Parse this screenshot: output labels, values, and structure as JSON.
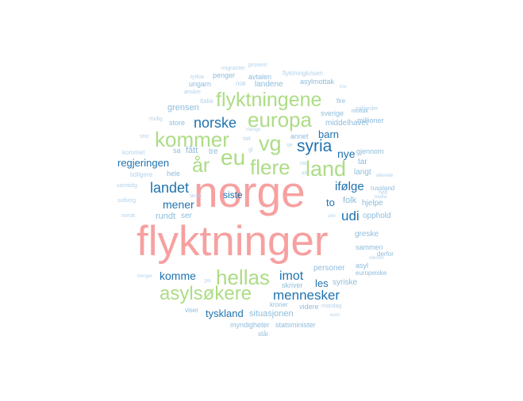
{
  "colors": {
    "background": "#ffffff",
    "pink": "#f7a0a0",
    "green": "#addc86",
    "darkblue": "#1f73b0",
    "midblue": "#8ebcdc",
    "lightblue": "#b3d3eb"
  },
  "words": [
    {
      "text": "norge",
      "color": "pink"
    },
    {
      "text": "flyktninger",
      "color": "pink"
    },
    {
      "text": "flyktningene",
      "color": "green"
    },
    {
      "text": "europa",
      "color": "green"
    },
    {
      "text": "kommer",
      "color": "green"
    },
    {
      "text": "vg",
      "color": "green"
    },
    {
      "text": "eu",
      "color": "green"
    },
    {
      "text": "syria",
      "color": "darkblue"
    },
    {
      "text": "år",
      "color": "green"
    },
    {
      "text": "flere",
      "color": "green"
    },
    {
      "text": "land",
      "color": "green"
    },
    {
      "text": "hellas",
      "color": "green"
    },
    {
      "text": "asylsøkere",
      "color": "green"
    },
    {
      "text": "norske",
      "color": "darkblue"
    },
    {
      "text": "landet",
      "color": "darkblue"
    },
    {
      "text": "regjeringen",
      "color": "darkblue"
    },
    {
      "text": "mener",
      "color": "darkblue"
    },
    {
      "text": "ifølge",
      "color": "darkblue"
    },
    {
      "text": "udi",
      "color": "darkblue"
    },
    {
      "text": "barn",
      "color": "darkblue"
    },
    {
      "text": "nye",
      "color": "darkblue"
    },
    {
      "text": "imot",
      "color": "darkblue"
    },
    {
      "text": "mennesker",
      "color": "darkblue"
    },
    {
      "text": "komme",
      "color": "darkblue"
    },
    {
      "text": "tyskland",
      "color": "darkblue"
    },
    {
      "text": "les",
      "color": "darkblue"
    },
    {
      "text": "siste",
      "color": "darkblue"
    },
    {
      "text": "to",
      "color": "darkblue"
    },
    {
      "text": "grensen",
      "color": "midblue"
    },
    {
      "text": "fått",
      "color": "midblue"
    },
    {
      "text": "tre",
      "color": "midblue"
    },
    {
      "text": "rundt",
      "color": "midblue"
    },
    {
      "text": "ser",
      "color": "midblue"
    },
    {
      "text": "folk",
      "color": "midblue"
    },
    {
      "text": "hjelpe",
      "color": "midblue"
    },
    {
      "text": "opphold",
      "color": "midblue"
    },
    {
      "text": "langt",
      "color": "midblue"
    },
    {
      "text": "tar",
      "color": "midblue"
    },
    {
      "text": "middelhavet",
      "color": "midblue"
    },
    {
      "text": "sverige",
      "color": "midblue"
    },
    {
      "text": "millioner",
      "color": "midblue"
    },
    {
      "text": "gjennom",
      "color": "midblue"
    },
    {
      "text": "annet",
      "color": "midblue"
    },
    {
      "text": "sammen",
      "color": "midblue"
    },
    {
      "text": "greske",
      "color": "midblue"
    },
    {
      "text": "personer",
      "color": "midblue"
    },
    {
      "text": "syriske",
      "color": "midblue"
    },
    {
      "text": "skriver",
      "color": "midblue"
    },
    {
      "text": "situasjonen",
      "color": "midblue"
    },
    {
      "text": "landene",
      "color": "midblue"
    },
    {
      "text": "avtalen",
      "color": "midblue"
    },
    {
      "text": "asylmottak",
      "color": "midblue"
    },
    {
      "text": "store",
      "color": "midblue"
    },
    {
      "text": "hele",
      "color": "midblue"
    },
    {
      "text": "sa",
      "color": "midblue"
    },
    {
      "text": "ungarn",
      "color": "midblue"
    },
    {
      "text": "penger",
      "color": "midblue"
    },
    {
      "text": "asyl",
      "color": "midblue"
    },
    {
      "text": "kroner",
      "color": "midblue"
    },
    {
      "text": "viser",
      "color": "midblue"
    },
    {
      "text": "videre",
      "color": "midblue"
    },
    {
      "text": "myndigheter",
      "color": "midblue"
    },
    {
      "text": "statsminister",
      "color": "midblue"
    },
    {
      "text": "står",
      "color": "midblue"
    },
    {
      "text": "derfor",
      "color": "midblue"
    },
    {
      "text": "europeiske",
      "color": "midblue"
    },
    {
      "text": "russland",
      "color": "midblue"
    },
    {
      "text": "mottak",
      "color": "midblue"
    },
    {
      "text": "fire",
      "color": "midblue"
    },
    {
      "text": "milliarder",
      "color": "lightblue"
    },
    {
      "text": "italia",
      "color": "lightblue"
    },
    {
      "text": "nok",
      "color": "lightblue"
    },
    {
      "text": "tyrkia",
      "color": "lightblue"
    },
    {
      "text": "ønsker",
      "color": "lightblue"
    },
    {
      "text": "mulig",
      "color": "lightblue"
    },
    {
      "text": "stor",
      "color": "lightblue"
    },
    {
      "text": "kommet",
      "color": "lightblue"
    },
    {
      "text": "tidligere",
      "color": "lightblue"
    },
    {
      "text": "samtidig",
      "color": "lightblue"
    },
    {
      "text": "solberg",
      "color": "lightblue"
    },
    {
      "text": "norsk",
      "color": "lightblue"
    },
    {
      "text": "første",
      "color": "lightblue"
    },
    {
      "text": "mange",
      "color": "lightblue"
    },
    {
      "text": "gi",
      "color": "lightblue"
    },
    {
      "text": "tatt",
      "color": "lightblue"
    },
    {
      "text": "se",
      "color": "lightblue"
    },
    {
      "text": "ntb",
      "color": "lightblue"
    },
    {
      "text": "alt",
      "color": "lightblue"
    },
    {
      "text": "uke",
      "color": "lightblue"
    },
    {
      "text": "pu",
      "color": "lightblue"
    },
    {
      "text": "trenger",
      "color": "lightblue"
    },
    {
      "text": "utenfor",
      "color": "lightblue"
    },
    {
      "text": "bedre",
      "color": "lightblue"
    },
    {
      "text": "helt",
      "color": "lightblue"
    },
    {
      "text": "allerede",
      "color": "lightblue"
    },
    {
      "text": "mandag",
      "color": "lightblue"
    },
    {
      "text": "euro",
      "color": "lightblue"
    },
    {
      "text": "flyktningkrisen",
      "color": "lightblue"
    },
    {
      "text": "migranter",
      "color": "lightblue"
    },
    {
      "text": "prosent",
      "color": "lightblue"
    },
    {
      "text": "tror",
      "color": "lightblue"
    }
  ]
}
